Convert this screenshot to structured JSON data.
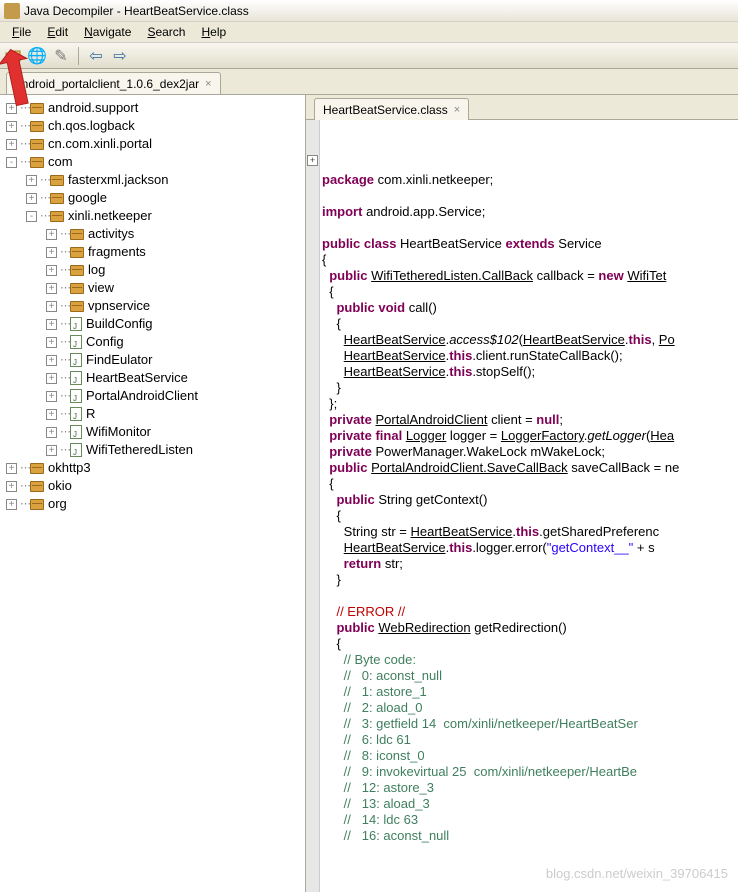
{
  "window": {
    "title": "Java Decompiler - HeartBeatService.class"
  },
  "menu": {
    "file": "File",
    "edit": "Edit",
    "navigate": "Navigate",
    "search": "Search",
    "help": "Help"
  },
  "toolbar": {
    "open": "open-icon",
    "globe": "globe-icon",
    "wand": "wand-icon",
    "back": "back-icon",
    "fwd": "forward-icon"
  },
  "navTab": {
    "label": "android_portalclient_1.0.6_dex2jar"
  },
  "editorTab": {
    "label": "HeartBeatService.class"
  },
  "tree": [
    {
      "d": 0,
      "t": "pkg",
      "exp": "+",
      "label": "android.support"
    },
    {
      "d": 0,
      "t": "pkg",
      "exp": "+",
      "label": "ch.qos.logback"
    },
    {
      "d": 0,
      "t": "pkg",
      "exp": "+",
      "label": "cn.com.xinli.portal"
    },
    {
      "d": 0,
      "t": "pkg",
      "exp": "-",
      "label": "com"
    },
    {
      "d": 1,
      "t": "pkg",
      "exp": "+",
      "label": "fasterxml.jackson"
    },
    {
      "d": 1,
      "t": "pkg",
      "exp": "+",
      "label": "google"
    },
    {
      "d": 1,
      "t": "pkg",
      "exp": "-",
      "label": "xinli.netkeeper"
    },
    {
      "d": 2,
      "t": "pkg",
      "exp": "+",
      "label": "activitys"
    },
    {
      "d": 2,
      "t": "pkg",
      "exp": "+",
      "label": "fragments"
    },
    {
      "d": 2,
      "t": "pkg",
      "exp": "+",
      "label": "log"
    },
    {
      "d": 2,
      "t": "pkg",
      "exp": "+",
      "label": "view"
    },
    {
      "d": 2,
      "t": "pkg",
      "exp": "+",
      "label": "vpnservice"
    },
    {
      "d": 2,
      "t": "cls",
      "exp": "+",
      "label": "BuildConfig"
    },
    {
      "d": 2,
      "t": "cls",
      "exp": "+",
      "label": "Config"
    },
    {
      "d": 2,
      "t": "cls",
      "exp": "+",
      "label": "FindEulator"
    },
    {
      "d": 2,
      "t": "cls",
      "exp": "+",
      "label": "HeartBeatService"
    },
    {
      "d": 2,
      "t": "cls",
      "exp": "+",
      "label": "PortalAndroidClient"
    },
    {
      "d": 2,
      "t": "cls",
      "exp": "+",
      "label": "R"
    },
    {
      "d": 2,
      "t": "cls",
      "exp": "+",
      "label": "WifiMonitor"
    },
    {
      "d": 2,
      "t": "cls",
      "exp": "+",
      "label": "WifiTetheredListen"
    },
    {
      "d": 0,
      "t": "pkg",
      "exp": "+",
      "label": "okhttp3"
    },
    {
      "d": 0,
      "t": "pkg",
      "exp": "+",
      "label": "okio"
    },
    {
      "d": 0,
      "t": "pkg",
      "exp": "+",
      "label": "org"
    }
  ],
  "code": {
    "package": "com.xinli.netkeeper",
    "import": "android.app.Service",
    "className": "HeartBeatService",
    "extends": "Service",
    "field1_type": "WifiTetheredListen.CallBack",
    "field1_name": "callback",
    "field1_new": "WifiTet",
    "anon1_sig": "call",
    "anon1_l1_a": "HeartBeatService",
    "anon1_l1_b": "access$102",
    "anon1_l1_c": "HeartBeatService",
    "anon1_l1_d": "Po",
    "anon1_l2_a": "HeartBeatService",
    "anon1_l2_b": "client",
    "anon1_l2_c": "runStateCallBack",
    "anon1_l3_a": "HeartBeatService",
    "anon1_l3_b": "stopSelf",
    "field2_type": "PortalAndroidClient",
    "field2_name": "client",
    "field3_type": "Logger",
    "field3_name": "logger",
    "field3_factory": "LoggerFactory",
    "field3_m": "getLogger",
    "field3_arg": "Hea",
    "field4_type": "PowerManager.WakeLock",
    "field4_name": "mWakeLock",
    "field5_type": "PortalAndroidClient.SaveCallBack",
    "field5_name": "saveCallBack",
    "field5_new": "ne",
    "m1_ret": "String",
    "m1_name": "getContext",
    "m1_l1_a": "String str = ",
    "m1_l1_b": "HeartBeatService",
    "m1_l1_c": ".getSharedPreferenc",
    "m1_l2_a": "HeartBeatService",
    "m1_l2_b": "logger",
    "m1_l2_c": "error",
    "m1_l2_s": "\"getContext__\"",
    "m1_l2_d": " + s",
    "m1_l3": "str",
    "errlbl": "// ERROR //",
    "m2_ret": "WebRedirection",
    "m2_name": "getRedirection",
    "bc_hdr": "// Byte code:",
    "bc": [
      "//   0: aconst_null",
      "//   1: astore_1",
      "//   2: aload_0",
      "//   3: getfield 14  com/xinli/netkeeper/HeartBeatSer",
      "//   6: ldc 61",
      "//   8: iconst_0",
      "//   9: invokevirtual 25  com/xinli/netkeeper/HeartBe",
      "//   12: astore_3",
      "//   13: aload_3",
      "//   14: ldc 63",
      "//   16: aconst_null"
    ]
  },
  "watermark": "blog.csdn.net/weixin_39706415"
}
